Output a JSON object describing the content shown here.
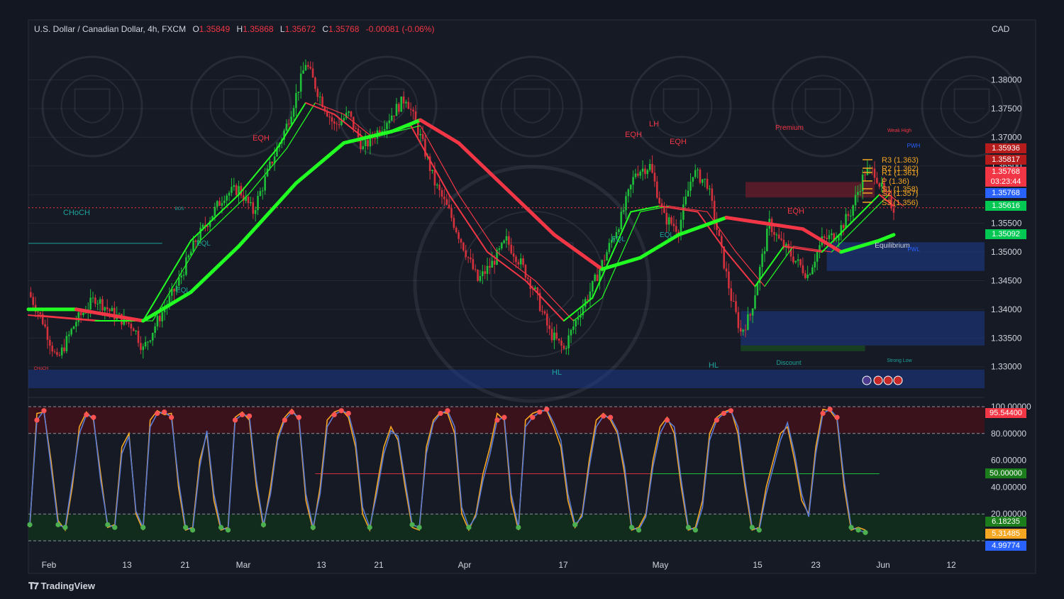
{
  "header": {
    "symbol": "U.S. Dollar / Canadian Dollar, 4h, FXCM",
    "o_label": "O",
    "o": "1.35849",
    "h_label": "H",
    "h": "1.35868",
    "l_label": "L",
    "l": "1.35672",
    "c_label": "C",
    "c": "1.35768",
    "change": "-0.00081 (-0.06%)"
  },
  "currency": "CAD",
  "brand": "TradingView",
  "colors": {
    "bg": "#131722",
    "up": "#22ff22",
    "down": "#f23645",
    "orange": "#f5a623",
    "blue": "#2962ff"
  },
  "chart_data": [
    {
      "type": "candlestick",
      "title": "U.S. Dollar / Canadian Dollar, 4h, FXCM",
      "ylim": [
        1.3265,
        1.3865
      ],
      "y_ticks": [
        "1.38000",
        "1.37500",
        "1.37000",
        "1.36500",
        "1.36000",
        "1.35500",
        "1.35000",
        "1.34500",
        "1.34000",
        "1.33500",
        "1.33000"
      ],
      "x_ticks": [
        "Feb",
        "13",
        "21",
        "Mar",
        "13",
        "21",
        "Apr",
        "17",
        "May",
        "15",
        "23",
        "Jun",
        "12"
      ],
      "price_path": [
        [
          0,
          1.343
        ],
        [
          3,
          1.338
        ],
        [
          6,
          1.331
        ],
        [
          10,
          1.338
        ],
        [
          14,
          1.342
        ],
        [
          18,
          1.339
        ],
        [
          22,
          1.337
        ],
        [
          24,
          1.333
        ],
        [
          27,
          1.338
        ],
        [
          31,
          1.344
        ],
        [
          35,
          1.352
        ],
        [
          38,
          1.356
        ],
        [
          41,
          1.36
        ],
        [
          44,
          1.361
        ],
        [
          47,
          1.357
        ],
        [
          51,
          1.366
        ],
        [
          54,
          1.372
        ],
        [
          57,
          1.38
        ],
        [
          58,
          1.383
        ],
        [
          61,
          1.377
        ],
        [
          64,
          1.372
        ],
        [
          67,
          1.374
        ],
        [
          70,
          1.368
        ],
        [
          73,
          1.371
        ],
        [
          76,
          1.374
        ],
        [
          79,
          1.377
        ],
        [
          82,
          1.37
        ],
        [
          85,
          1.362
        ],
        [
          88,
          1.357
        ],
        [
          91,
          1.351
        ],
        [
          94,
          1.345
        ],
        [
          97,
          1.348
        ],
        [
          100,
          1.352
        ],
        [
          103,
          1.348
        ],
        [
          106,
          1.343
        ],
        [
          109,
          1.336
        ],
        [
          112,
          1.333
        ],
        [
          115,
          1.339
        ],
        [
          118,
          1.344
        ],
        [
          121,
          1.35
        ],
        [
          124,
          1.356
        ],
        [
          127,
          1.364
        ],
        [
          130,
          1.365
        ],
        [
          133,
          1.356
        ],
        [
          136,
          1.354
        ],
        [
          139,
          1.364
        ],
        [
          142,
          1.362
        ],
        [
          145,
          1.35
        ],
        [
          147,
          1.342
        ],
        [
          149,
          1.336
        ],
        [
          151,
          1.339
        ],
        [
          153,
          1.347
        ],
        [
          155,
          1.355
        ],
        [
          157,
          1.352
        ],
        [
          160,
          1.349
        ],
        [
          163,
          1.346
        ],
        [
          166,
          1.352
        ],
        [
          169,
          1.353
        ],
        [
          172,
          1.357
        ],
        [
          175,
          1.364
        ],
        [
          177,
          1.364
        ],
        [
          179,
          1.36
        ],
        [
          181,
          1.3577
        ]
      ],
      "ema_fast": [
        [
          0,
          1.339
        ],
        [
          14,
          1.338
        ],
        [
          24,
          1.338
        ],
        [
          34,
          1.352
        ],
        [
          44,
          1.36
        ],
        [
          52,
          1.368
        ],
        [
          58,
          1.376
        ],
        [
          64,
          1.374
        ],
        [
          70,
          1.37
        ],
        [
          80,
          1.372
        ],
        [
          88,
          1.36
        ],
        [
          96,
          1.35
        ],
        [
          104,
          1.345
        ],
        [
          112,
          1.338
        ],
        [
          118,
          1.342
        ],
        [
          126,
          1.357
        ],
        [
          132,
          1.358
        ],
        [
          140,
          1.357
        ],
        [
          146,
          1.35
        ],
        [
          152,
          1.344
        ],
        [
          158,
          1.351
        ],
        [
          166,
          1.35
        ],
        [
          172,
          1.355
        ],
        [
          178,
          1.36
        ],
        [
          181,
          1.358
        ]
      ],
      "ema_slow": [
        [
          0,
          1.34
        ],
        [
          10,
          1.34
        ],
        [
          24,
          1.338
        ],
        [
          34,
          1.343
        ],
        [
          44,
          1.351
        ],
        [
          56,
          1.362
        ],
        [
          66,
          1.369
        ],
        [
          76,
          1.371
        ],
        [
          82,
          1.373
        ],
        [
          90,
          1.369
        ],
        [
          100,
          1.361
        ],
        [
          110,
          1.353
        ],
        [
          120,
          1.347
        ],
        [
          128,
          1.349
        ],
        [
          136,
          1.353
        ],
        [
          146,
          1.356
        ],
        [
          154,
          1.355
        ],
        [
          162,
          1.354
        ],
        [
          170,
          1.35
        ],
        [
          178,
          1.352
        ],
        [
          181,
          1.353
        ]
      ],
      "levels": [
        {
          "label": "R3 (1.363)",
          "value": 1.363
        },
        {
          "label": "R2 (1.362)",
          "value": 1.362
        },
        {
          "label": "R1 (1.361)",
          "value": 1.361
        },
        {
          "label": "P (1.36)",
          "value": 1.36
        },
        {
          "label": "S1 (1.358)",
          "value": 1.358
        },
        {
          "label": "S2 (1.357)",
          "value": 1.357
        },
        {
          "label": "S3 (1.356)",
          "value": 1.356
        }
      ],
      "price_tags": [
        {
          "value": "1.35936",
          "color": "#b71c1c"
        },
        {
          "value": "1.35817",
          "color": "#b71c1c"
        },
        {
          "value": "1.35768",
          "color": "#f23645"
        },
        {
          "value": "03:23:44",
          "color": "#f23645"
        },
        {
          "value": "1.35768",
          "color": "#2962ff"
        },
        {
          "value": "1.35616",
          "color": "#00c853"
        },
        {
          "value": "1.35092",
          "color": "#00c853"
        }
      ],
      "annotations": [
        "CHoCH",
        "EQL",
        "EQL",
        "EQH",
        "EQH",
        "LH",
        "EQH",
        "EQH",
        "EQL",
        "EQL",
        "HL",
        "HL",
        "Premium",
        "Equilibrium",
        "Discount",
        "Weak High",
        "Strong Low",
        "PWH",
        "PWL",
        "BOS",
        "CHoCH"
      ]
    },
    {
      "type": "line",
      "title": "",
      "ylim": [
        0,
        100
      ],
      "y_ticks": [
        "100.00000",
        "80.00000",
        "60.00000",
        "40.00000",
        "20.00000"
      ],
      "series": [
        {
          "values": [
            10,
            95,
            96,
            60,
            15,
            8,
            40,
            85,
            96,
            90,
            50,
            10,
            12,
            70,
            80,
            20,
            8,
            90,
            97,
            94,
            95,
            40,
            8,
            10,
            60,
            80,
            30,
            8,
            10,
            92,
            96,
            90,
            40,
            10,
            40,
            78,
            92,
            98,
            90,
            30,
            8,
            40,
            90,
            96,
            98,
            92,
            70,
            20,
            8,
            40,
            70,
            85,
            75,
            40,
            10,
            8,
            70,
            90,
            96,
            95,
            80,
            20,
            8,
            20,
            50,
            70,
            95,
            90,
            30,
            8,
            90,
            95,
            97,
            97,
            85,
            70,
            30,
            10,
            20,
            60,
            90,
            95,
            90,
            80,
            50,
            8,
            10,
            20,
            60,
            85,
            92,
            80,
            40,
            8,
            10,
            30,
            80,
            92,
            96,
            98,
            80,
            40,
            8,
            10,
            40,
            60,
            80,
            85,
            60,
            30,
            20,
            70,
            98,
            97,
            90,
            40,
            8,
            10,
            8
          ]
        },
        {
          "values": [
            12,
            90,
            97,
            55,
            12,
            10,
            45,
            80,
            94,
            92,
            45,
            12,
            10,
            65,
            78,
            22,
            10,
            85,
            95,
            96,
            92,
            45,
            10,
            8,
            55,
            82,
            35,
            10,
            8,
            90,
            94,
            93,
            45,
            12,
            35,
            75,
            90,
            96,
            92,
            35,
            10,
            35,
            85,
            94,
            97,
            95,
            75,
            25,
            10,
            35,
            65,
            82,
            78,
            45,
            12,
            10,
            65,
            88,
            95,
            97,
            85,
            25,
            10,
            18,
            45,
            65,
            90,
            92,
            35,
            10,
            85,
            92,
            96,
            98,
            88,
            75,
            35,
            12,
            18,
            55,
            85,
            93,
            92,
            82,
            55,
            10,
            8,
            18,
            55,
            80,
            90,
            85,
            45,
            10,
            8,
            25,
            75,
            90,
            95,
            97,
            85,
            45,
            10,
            8,
            35,
            55,
            75,
            88,
            65,
            35,
            18,
            65,
            95,
            98,
            92,
            45,
            10,
            8,
            6.2
          ]
        }
      ],
      "price_tags": [
        {
          "value": "95.54400",
          "color": "#f23645"
        },
        {
          "value": "50.00000",
          "color": "#1b7d1b"
        },
        {
          "value": "6.18235",
          "color": "#1b7d1b"
        },
        {
          "value": "5.31485",
          "color": "#f5a623"
        },
        {
          "value": "4.99774",
          "color": "#2962ff"
        }
      ]
    }
  ]
}
